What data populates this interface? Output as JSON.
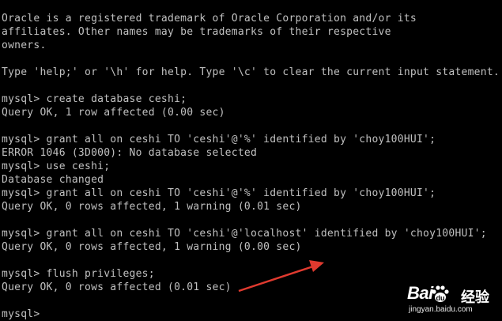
{
  "terminal": {
    "lines": [
      "Oracle is a registered trademark of Oracle Corporation and/or its",
      "affiliates. Other names may be trademarks of their respective",
      "owners.",
      "",
      "Type 'help;' or '\\h' for help. Type '\\c' to clear the current input statement.",
      "",
      "mysql> create database ceshi;",
      "Query OK, 1 row affected (0.00 sec)",
      "",
      "mysql> grant all on ceshi TO 'ceshi'@'%' identified by 'choy100HUI';",
      "ERROR 1046 (3D000): No database selected",
      "mysql> use ceshi;",
      "Database changed",
      "mysql> grant all on ceshi TO 'ceshi'@'%' identified by 'choy100HUI';",
      "Query OK, 0 rows affected, 1 warning (0.01 sec)",
      "",
      "mysql> grant all on ceshi TO 'ceshi'@'localhost' identified by 'choy100HUI';",
      "Query OK, 0 rows affected, 1 warning (0.00 sec)",
      "",
      "mysql> flush privileges;",
      "Query OK, 0 rows affected (0.01 sec)",
      "",
      "mysql>"
    ]
  },
  "annotation": {
    "arrow_color": "#e03a2f",
    "arrow_icon": "red-arrow-icon"
  },
  "watermark": {
    "logo": "Bai",
    "logo_suffix": "du",
    "chinese": "经验",
    "url": "jingyan.baidu.com"
  },
  "colors": {
    "background": "#000000",
    "text": "#c0c0c0"
  }
}
